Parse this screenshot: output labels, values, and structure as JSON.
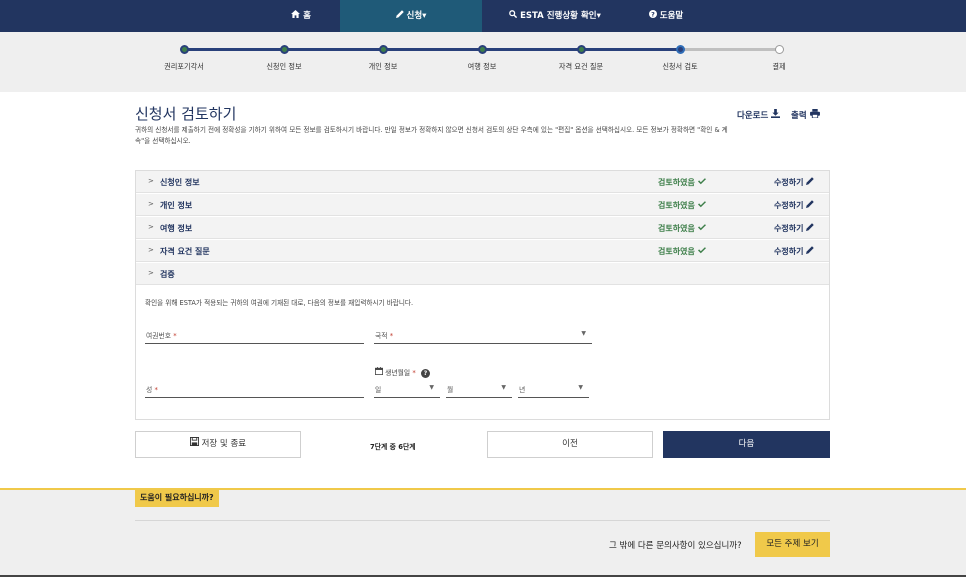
{
  "nav": {
    "home": "홈",
    "apply": "신청",
    "status": "ESTA 진행상황 확인",
    "help": "도움말",
    "caret": "▾",
    "colors": {
      "bar": "#223560",
      "active": "#1f5a78"
    }
  },
  "progress": {
    "steps": [
      "권리포기각서",
      "신청인 정보",
      "개인 정보",
      "여행 정보",
      "자격 요건 질문",
      "신청서 검토",
      "결제"
    ],
    "current_index": 5
  },
  "header": {
    "title": "신청서 검토하기",
    "intro": "귀하의 신청서를 제출하기 전에 정확성을 기하기 위하여 모든 정보를 검토하시기 바랍니다. 만일 정보가 정확하지 않으면 신청서 검토의 상단 우측에 있는 \"편집\" 옵션을 선택하십시오. 모든 정보가 정확하면 \"확인 & 계속\"을 선택하십시오.",
    "download": "다운로드",
    "print": "출력"
  },
  "sections": {
    "applicant": {
      "title": "신청인 정보",
      "status": "검토하였음",
      "edit": "수정하기"
    },
    "personal": {
      "title": "개인 정보",
      "status": "검토하였음",
      "edit": "수정하기"
    },
    "travel": {
      "title": "여행 정보",
      "status": "검토하였음",
      "edit": "수정하기"
    },
    "eligibility": {
      "title": "자격 요건 질문",
      "status": "검토하였음",
      "edit": "수정하기"
    },
    "verify": {
      "title": "검증"
    }
  },
  "verification": {
    "instructions": "확인을 위해 ESTA가 적용되는 귀하의 여권에 기재된 대로, 다음의 정보를 재입력하시기 바랍니다.",
    "passport_label": "여권번호",
    "country_label": "국적",
    "surname_label": "성",
    "dob_label": "생년월일",
    "day_label": "일",
    "month_label": "월",
    "year_label": "년",
    "required_mark": "*"
  },
  "actions": {
    "save_exit": "저장 및 종료",
    "step_count": "7단계 중 6단계",
    "previous": "이전",
    "next": "다음"
  },
  "help": {
    "title": "도움이 필요하십니까?",
    "question": "그 밖에 다른 문의사항이 있으십니까?",
    "button": "모든 주제 보기"
  },
  "icons": {
    "home": "home-icon",
    "pencil": "pencil-icon",
    "search": "search-icon",
    "question": "question-circle-icon",
    "check": "check-icon",
    "download": "download-icon",
    "print": "print-icon",
    "save": "floppy-disk-icon",
    "calendar": "calendar-icon",
    "chevron": "chevron-right-icon"
  },
  "colors": {
    "navy": "#223560",
    "green": "#3e7f4a",
    "yellow": "#f0c94a"
  }
}
